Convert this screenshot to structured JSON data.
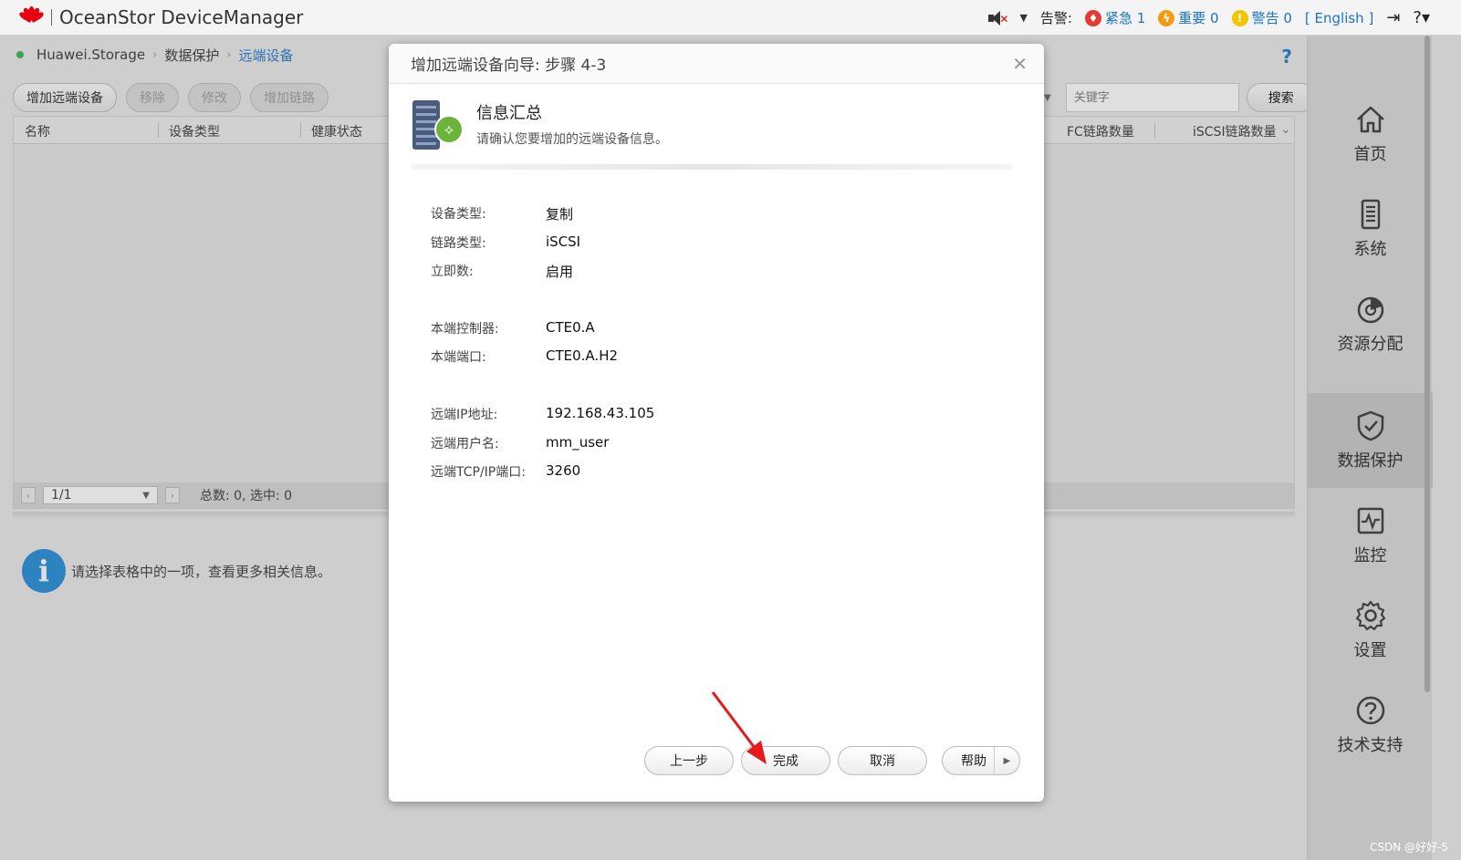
{
  "topbar": {
    "brand_small": "HUAWEI",
    "title": "OceanStor DeviceManager",
    "alarm_label": "告警:",
    "alarms": [
      {
        "label": "紧急 1",
        "icon": "flame-icon",
        "color": "#e53935"
      },
      {
        "label": "重要 0",
        "icon": "bolt-icon",
        "color": "#f39c12"
      },
      {
        "label": "警告 0",
        "icon": "exclamation-icon",
        "color": "#f2c500"
      }
    ],
    "language": "[ English ]"
  },
  "breadcrumb": {
    "items": [
      "Huawei.Storage",
      "数据保护",
      "远端设备"
    ]
  },
  "toolbar": {
    "buttons": [
      "增加远端设备",
      "移除",
      "修改",
      "增加链路"
    ],
    "keyword_placeholder": "关键字",
    "search_label": "搜索"
  },
  "table": {
    "columns_left": [
      "名称",
      "设备类型",
      "健康状态"
    ],
    "columns_right": [
      "FC链路数量",
      "iSCSI链路数量"
    ],
    "page_value": "1/1",
    "summary": "总数: 0, 选中: 0"
  },
  "info_message": "请选择表格中的一项，查看更多相关信息。",
  "rightnav": {
    "items": [
      {
        "label": "首页",
        "icon": "home-icon"
      },
      {
        "label": "系统",
        "icon": "system-icon"
      },
      {
        "label": "资源分配",
        "icon": "resource-icon"
      },
      {
        "label": "数据保护",
        "icon": "shield-icon",
        "active": true
      },
      {
        "label": "监控",
        "icon": "monitor-icon"
      },
      {
        "label": "设置",
        "icon": "gear-icon"
      },
      {
        "label": "技术支持",
        "icon": "question-icon"
      }
    ]
  },
  "watermark": "CSDN @好好-5",
  "dialog": {
    "title": "增加远端设备向导: 步骤 4-3",
    "summary_title": "信息汇总",
    "summary_subtitle": "请确认您要增加的远端设备信息。",
    "fields": [
      {
        "label": "设备类型:",
        "value": "复制"
      },
      {
        "label": "链路类型:",
        "value": "iSCSI"
      },
      {
        "label": "立即数:",
        "value": "启用"
      },
      {
        "label": "本端控制器:",
        "value": "CTE0.A"
      },
      {
        "label": "本端端口:",
        "value": "CTE0.A.H2"
      },
      {
        "label": "远端IP地址:",
        "value": "192.168.43.105"
      },
      {
        "label": "远端用户名:",
        "value": "mm_user"
      },
      {
        "label": "远端TCP/IP端口:",
        "value": "3260"
      }
    ],
    "buttons": {
      "prev": "上一步",
      "finish": "完成",
      "cancel": "取消",
      "help": "帮助"
    }
  }
}
